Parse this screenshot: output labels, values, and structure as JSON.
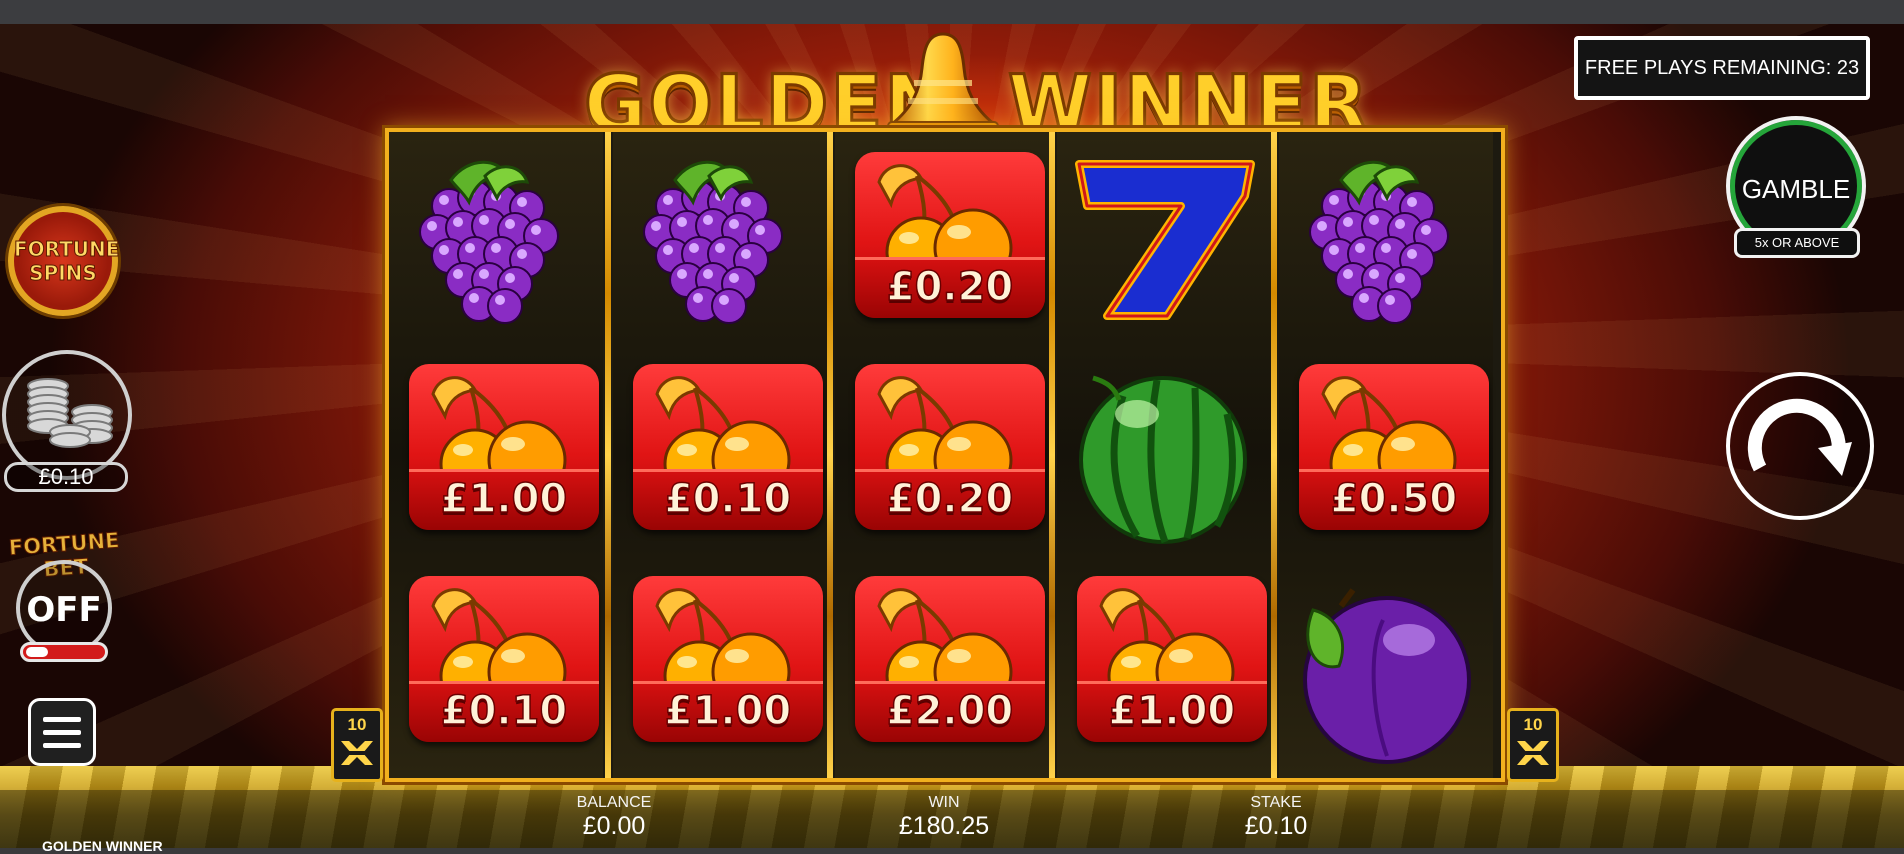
{
  "game": {
    "logo_left": "GOLDEN",
    "logo_right": "WINNER",
    "name_strip": "GOLDEN WINNER"
  },
  "free_plays": {
    "label": "FREE PLAYS REMAINING: 23"
  },
  "gamble": {
    "label": "GAMBLE",
    "sublabel": "5x OR ABOVE"
  },
  "left_panel": {
    "fortune_spins_line1": "FORTUNE",
    "fortune_spins_line2": "SPINS",
    "coin_value": "£0.10",
    "fortune_bet_label": "FORTUNE BET",
    "fortune_bet_state": "OFF"
  },
  "multipliers": {
    "left": "10",
    "right": "10"
  },
  "reels": [
    [
      {
        "symbol": "grapes"
      },
      {
        "symbol": "cherry",
        "value": "£1.00"
      },
      {
        "symbol": "cherry",
        "value": "£0.10"
      }
    ],
    [
      {
        "symbol": "grapes"
      },
      {
        "symbol": "cherry",
        "value": "£0.10"
      },
      {
        "symbol": "cherry",
        "value": "£1.00"
      }
    ],
    [
      {
        "symbol": "cherry",
        "value": "£0.20"
      },
      {
        "symbol": "cherry",
        "value": "£0.20"
      },
      {
        "symbol": "cherry",
        "value": "£2.00"
      }
    ],
    [
      {
        "symbol": "seven"
      },
      {
        "symbol": "watermelon"
      },
      {
        "symbol": "cherry",
        "value": "£1.00"
      }
    ],
    [
      {
        "symbol": "grapes"
      },
      {
        "symbol": "cherry",
        "value": "£0.50"
      },
      {
        "symbol": "plum"
      }
    ]
  ],
  "hud": {
    "balance_label": "BALANCE",
    "balance_value": "£0.00",
    "win_label": "WIN",
    "win_value": "£180.25",
    "stake_label": "STAKE",
    "stake_value": "£0.10"
  },
  "colors": {
    "reel_frame": "#f2b01e",
    "tile_red": "#e01414",
    "gamble_ring": "#25a53a",
    "fortune_bet_toggle": "#d21b1b"
  }
}
